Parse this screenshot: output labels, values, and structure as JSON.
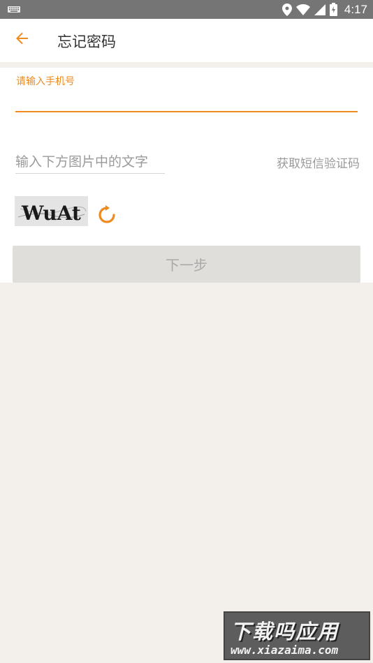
{
  "status_bar": {
    "time": "4:17"
  },
  "app_bar": {
    "title": "忘记密码",
    "back_icon": "arrow-left-icon"
  },
  "form": {
    "phone_label": "请输入手机号",
    "phone_value": "",
    "captcha_placeholder": "输入下方图片中的文字",
    "sms_link": "获取短信验证码",
    "captcha_text": "WuAt",
    "refresh_icon": "refresh-icon",
    "next_button": "下一步"
  },
  "watermark": {
    "cn": "下载吗应用",
    "en": "www.xiazaima.com"
  },
  "colors": {
    "accent": "#ef8a1c",
    "background": "#f3f0eb",
    "status_bar": "#757575",
    "button_disabled": "#dfdedb"
  }
}
